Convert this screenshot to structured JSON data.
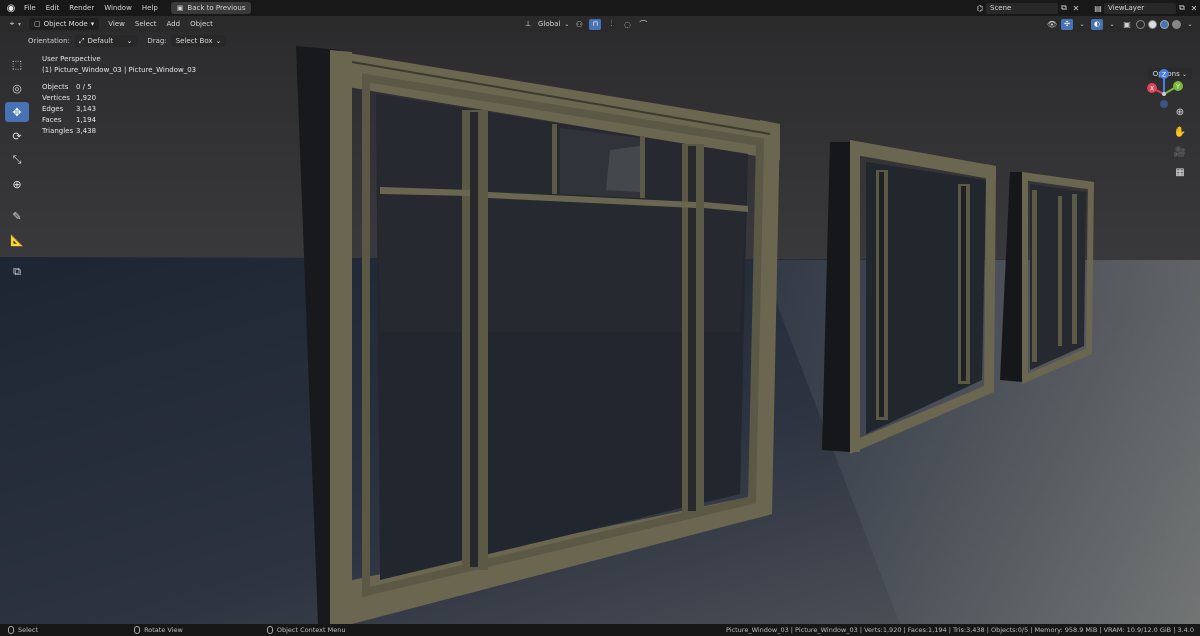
{
  "menu": {
    "items": [
      "File",
      "Edit",
      "Render",
      "Window",
      "Help"
    ],
    "back_button": "Back to Previous"
  },
  "topright": {
    "scene": "Scene",
    "view_layer": "ViewLayer"
  },
  "header": {
    "mode": "Object Mode",
    "menus": [
      "View",
      "Select",
      "Add",
      "Object"
    ],
    "transform_orientation": "Global",
    "options": "Options"
  },
  "tool_settings": {
    "orientation_label": "Orientation:",
    "orientation_value": "Default",
    "drag_label": "Drag:",
    "drag_value": "Select Box"
  },
  "overlay": {
    "perspective": "User Perspective",
    "object_name": "(1) Picture_Window_03 | Picture_Window_03",
    "stats": [
      {
        "label": "Objects",
        "value": "0 / 5"
      },
      {
        "label": "Vertices",
        "value": "1,920"
      },
      {
        "label": "Edges",
        "value": "3,143"
      },
      {
        "label": "Faces",
        "value": "1,194"
      },
      {
        "label": "Triangles",
        "value": "3,438"
      }
    ]
  },
  "gizmo": {
    "z": "Z",
    "y": "Y",
    "x": "X"
  },
  "status": {
    "select": "Select",
    "rotate": "Rotate View",
    "context": "Object Context Menu",
    "info": "Picture_Window_03 | Picture_Window_03 | Verts:1,920 | Faces:1,194 | Tris:3,438 | Objects:0/5 | Memory: 958.9 MiB | VRAM: 10.9/12.0 GiB | 3.4.0"
  },
  "colors": {
    "accent": "#4772b3",
    "wall": "#353538",
    "floor": "#1f2633",
    "frame": "#6b6650"
  }
}
